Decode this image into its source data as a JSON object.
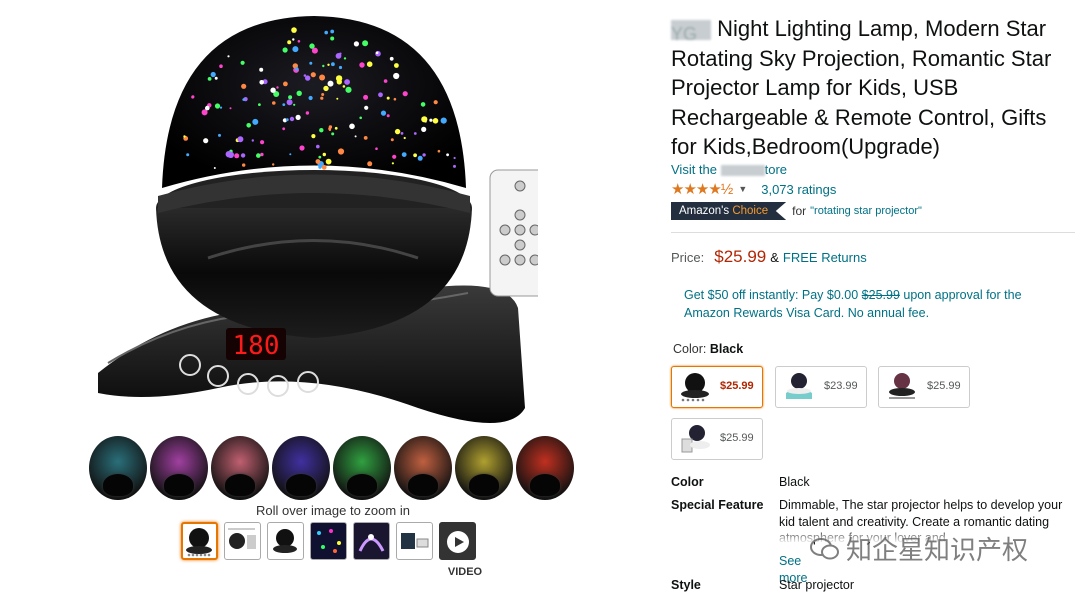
{
  "title": {
    "brand_blurred": "YG",
    "text": " Night Lighting Lamp, Modern Star Rotating Sky Projection, Romantic Star Projector Lamp for Kids, USB Rechargeable & Remote Control, Gifts for Kids,Bedroom(Upgrade)"
  },
  "store": {
    "prefix": "Visit the ",
    "suffix": "tore"
  },
  "rating": {
    "stars": "★★★★½",
    "count": "3,073 ratings",
    "chevron_icon": "chevron-down-icon"
  },
  "choice": {
    "badge_main": "Amazon's ",
    "badge_accent": "Choice",
    "for_text": "for",
    "keyword": "\"rotating star projector\""
  },
  "price": {
    "label": "Price:",
    "value": "$25.99",
    "amp": "&",
    "free_returns": "FREE Returns"
  },
  "promo": {
    "part1": "Get $50 off instantly: Pay $0.00 ",
    "strike": "$25.99",
    "part2": " upon approval for the Amazon Rewards Visa Card. No annual fee."
  },
  "color_selector": {
    "label": "Color: ",
    "selected": "Black"
  },
  "options": [
    {
      "price": "$25.99",
      "selected": true
    },
    {
      "price": "$23.99",
      "selected": false
    },
    {
      "price": "$25.99",
      "selected": false
    },
    {
      "price": "$25.99",
      "selected": false
    }
  ],
  "specs": [
    {
      "key": "Color",
      "value": "Black"
    },
    {
      "key": "Special Feature",
      "value": "Dimmable, The star projector helps to develop your kid talent and creativity. Create a romantic dating atmosphere for your lover and",
      "more": "See more"
    },
    {
      "key": "Style",
      "value": "Star projector"
    }
  ],
  "media": {
    "zoom_hint": "Roll over image to zoom in",
    "lamp_display": "180",
    "video_label": "VIDEO"
  },
  "swatch_colors": [
    "#2a6f7a",
    "#a040a0",
    "#c06070",
    "#4030a0",
    "#30a040",
    "#c06040",
    "#b0a030",
    "#c03020"
  ],
  "watermark": "知企星知识产权",
  "colors": {
    "link": "#007185",
    "price": "#b12704",
    "star": "#de7921",
    "badge_bg": "#232f3e",
    "selected_border": "#e77600"
  }
}
